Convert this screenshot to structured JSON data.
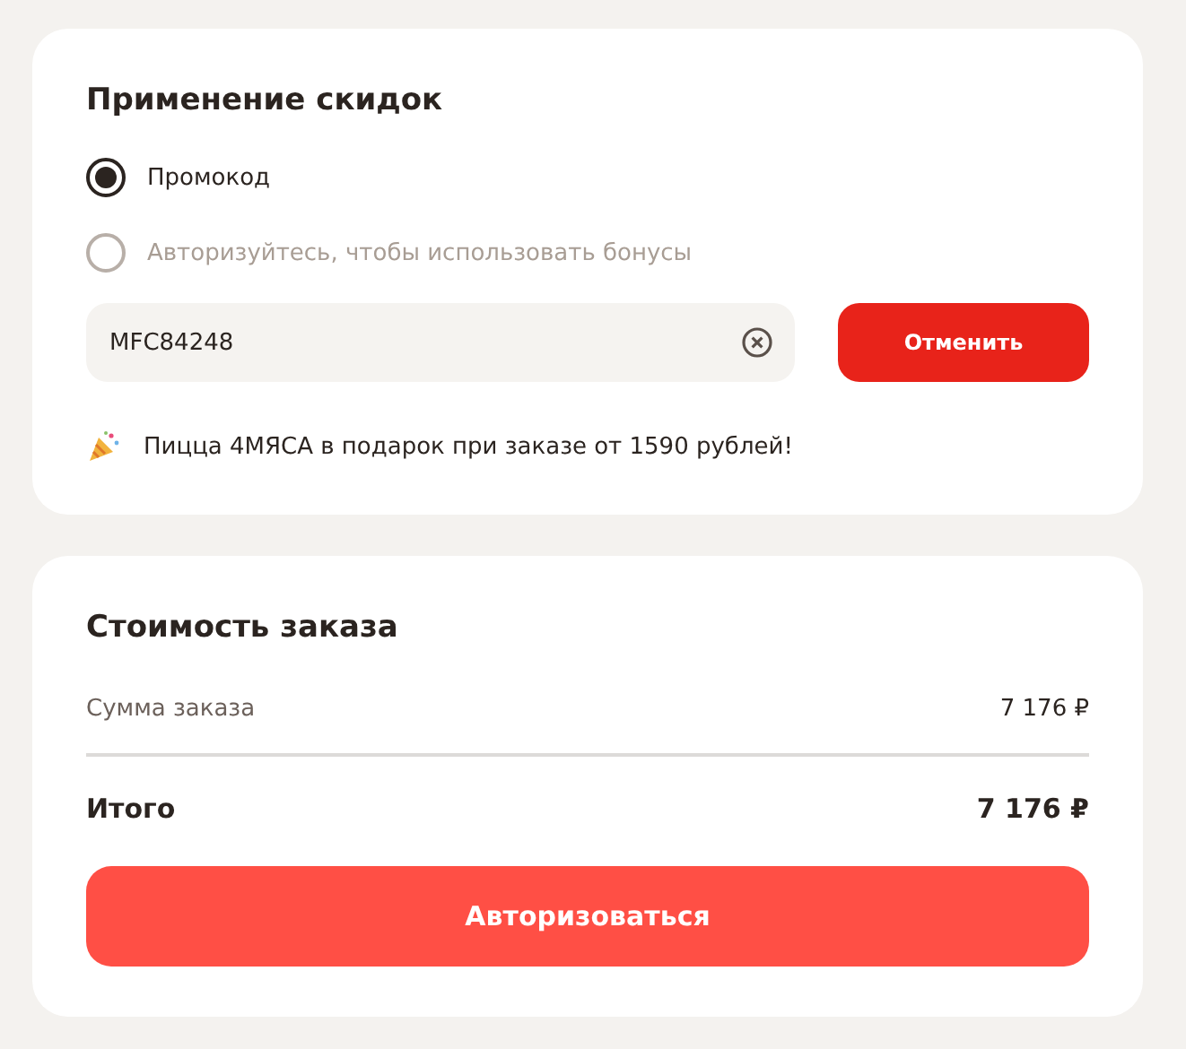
{
  "discounts": {
    "title": "Применение скидок",
    "options": [
      {
        "label": "Промокод",
        "selected": true,
        "disabled": false
      },
      {
        "label": "Авторизуйтесь, чтобы использовать бонусы",
        "selected": false,
        "disabled": true
      }
    ],
    "promo_field": {
      "value": "MFC84248"
    },
    "cancel_button": "Отменить",
    "notice": "Пицца 4МЯСА в подарок при заказе от 1590 рублей!"
  },
  "order": {
    "title": "Стоимость заказа",
    "subtotal": {
      "label": "Сумма заказа",
      "value": "7 176 ₽"
    },
    "total": {
      "label": "Итого",
      "value": "7 176 ₽"
    },
    "login_button": "Авторизоваться"
  }
}
